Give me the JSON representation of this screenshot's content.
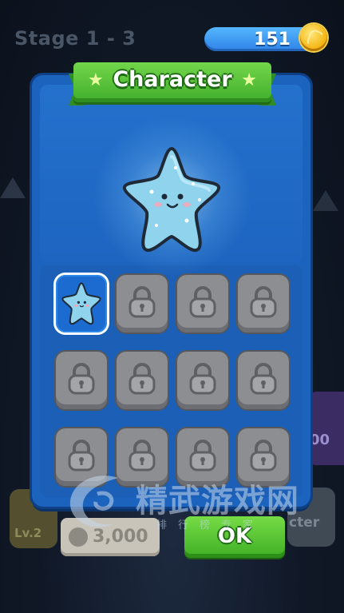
{
  "background": {
    "stage_label": "Stage 1 - 3",
    "left_card_label": "Lv.2",
    "right_card_label": "cter",
    "purple_card_label": "00"
  },
  "currency": {
    "coins": "151",
    "icon": "gold-coin-icon"
  },
  "dialog": {
    "title": "Character",
    "title_decoration_icon": "star-icon",
    "featured_character": "blue-star-character",
    "grid": {
      "columns": 4,
      "rows": 3,
      "slots": [
        {
          "state": "selected",
          "icon": "blue-star-character-icon"
        },
        {
          "state": "locked",
          "icon": "padlock-icon"
        },
        {
          "state": "locked",
          "icon": "padlock-icon"
        },
        {
          "state": "locked",
          "icon": "padlock-icon"
        },
        {
          "state": "locked",
          "icon": "padlock-icon"
        },
        {
          "state": "locked",
          "icon": "padlock-icon"
        },
        {
          "state": "locked",
          "icon": "padlock-icon"
        },
        {
          "state": "locked",
          "icon": "padlock-icon"
        },
        {
          "state": "locked",
          "icon": "padlock-icon"
        },
        {
          "state": "locked",
          "icon": "padlock-icon"
        },
        {
          "state": "locked",
          "icon": "padlock-icon"
        },
        {
          "state": "locked",
          "icon": "padlock-icon"
        }
      ]
    },
    "unlock_price": "3,000",
    "ok_label": "OK"
  },
  "watermark": {
    "title": "精武游戏网",
    "subtitle": "排行榜专家"
  },
  "colors": {
    "panel_blue": "#1c63bd",
    "ribbon_green": "#41ad2c",
    "slot_grey": "#8c8e92",
    "coin_gold": "#f5b91a"
  }
}
